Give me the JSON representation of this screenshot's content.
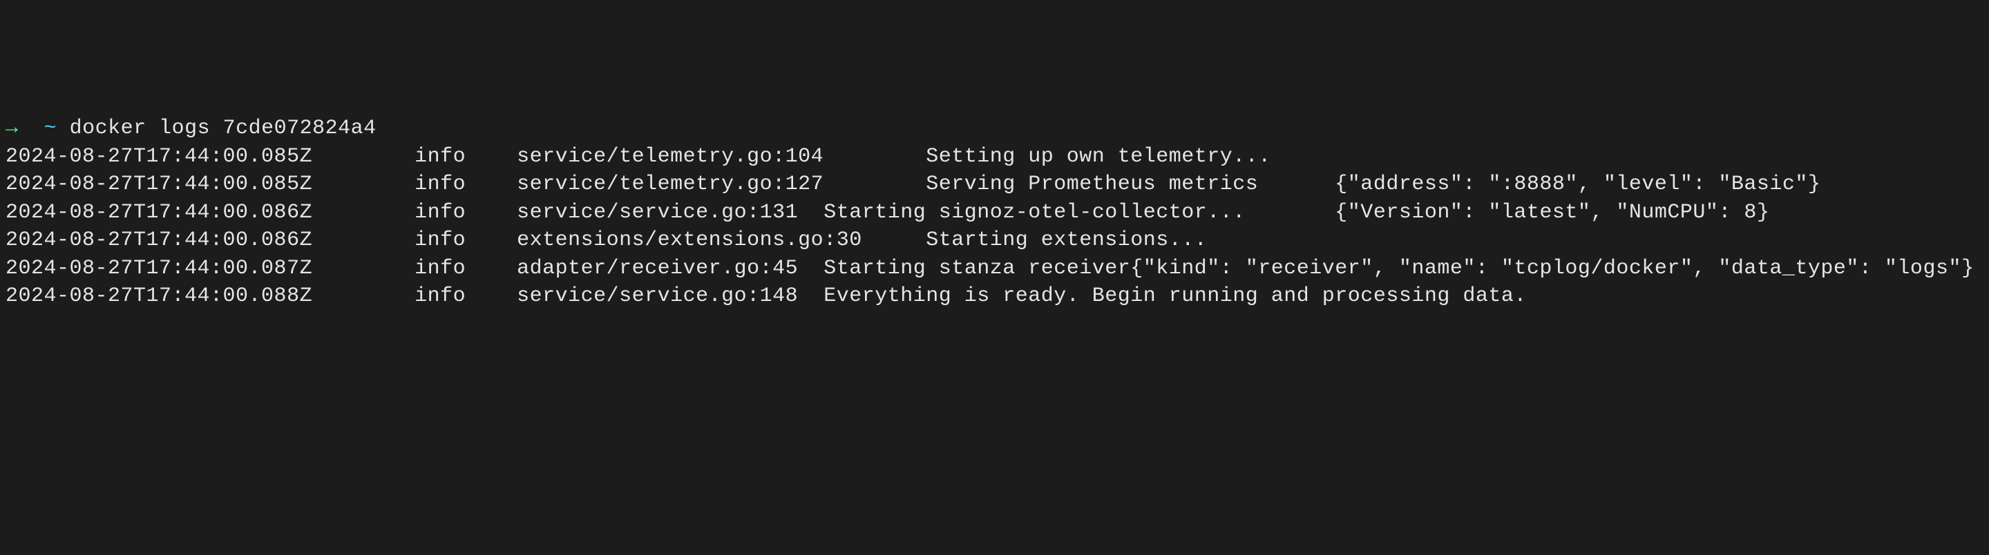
{
  "prompt": {
    "arrow": "→",
    "tilde": "~",
    "command": "docker logs 7cde072824a4"
  },
  "logs": "2024-08-27T17:44:00.085Z        info    service/telemetry.go:104        Setting up own telemetry...\n2024-08-27T17:44:00.085Z        info    service/telemetry.go:127        Serving Prometheus metrics      {\"address\": \":8888\", \"level\": \"Basic\"}\n2024-08-27T17:44:00.086Z        info    service/service.go:131  Starting signoz-otel-collector...       {\"Version\": \"latest\", \"NumCPU\": 8}\n2024-08-27T17:44:00.086Z        info    extensions/extensions.go:30     Starting extensions...\n2024-08-27T17:44:00.087Z        info    adapter/receiver.go:45  Starting stanza receiver{\"kind\": \"receiver\", \"name\": \"tcplog/docker\", \"data_type\": \"logs\"}\n2024-08-27T17:44:00.088Z        info    service/service.go:148  Everything is ready. Begin running and processing data."
}
